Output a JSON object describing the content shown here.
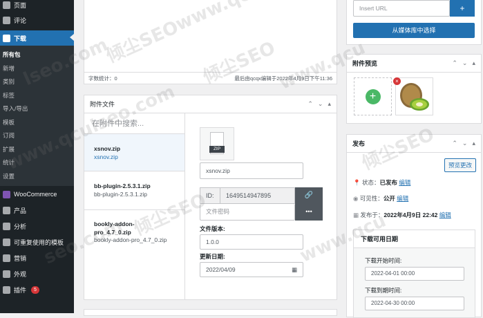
{
  "sidebar": {
    "pages_label": "页面",
    "comments_label": "评论",
    "downloads_label": "下载",
    "sub_items": [
      "所有包",
      "新增",
      "类别",
      "标签",
      "导入/导出",
      "模板",
      "订阅",
      "扩展",
      "统计",
      "设置"
    ],
    "woocommerce_label": "WooCommerce",
    "products_label": "产品",
    "analytics_label": "分析",
    "reusable_blocks_label": "可重复使用的模板",
    "marketing_label": "营销",
    "appearance_label": "外观",
    "plugins_label": "插件",
    "plugins_badge": "5"
  },
  "editor": {
    "word_count": "字数统计：0",
    "last_edited": "最后由qcqx编辑于2022年4月9日下午11:36"
  },
  "attachments": {
    "title": "附件文件",
    "search_placeholder": "在附件中搜索...",
    "files": [
      {
        "title": "xsnov.zip",
        "sub": "xsnov.zip"
      },
      {
        "title": "bb-plugin-2.5.3.1.zip",
        "sub": "bb-plugin-2.5.3.1.zip"
      },
      {
        "title": "bookly-addon-pro_4.7_0.zip",
        "sub": "bookly-addon-pro_4.7_0.zip"
      }
    ],
    "detail": {
      "file_icon_text": "ZIP",
      "filename": "xsnov.zip",
      "id_label": "ID:",
      "id_value": "1649514947895",
      "password_placeholder": "文件密码",
      "version_label": "文件版本:",
      "version_value": "1.0.0",
      "updated_label": "更新日期:",
      "updated_value": "2022/04/09"
    }
  },
  "url_box": {
    "insert_url_placeholder": "Insert URL",
    "media_button": "从媒体库中选择"
  },
  "preview": {
    "title": "附件预览"
  },
  "publish": {
    "title": "发布",
    "preview_button": "预览更改",
    "status_label": "状态：",
    "status_value": "已发布",
    "edit": "编辑",
    "visibility_label": "可见性：",
    "visibility_value": "公开",
    "published_label": "发布于：",
    "published_value": "2022年4月9日 22:42",
    "dates_title": "下载可用日期",
    "start_label": "下载开始时间:",
    "start_value": "2022-04-01 00:00",
    "end_label": "下载到期时间:",
    "end_value": "2022-04-30 00:00"
  },
  "watermarks": [
    "倾尘SEO",
    "www.qcu",
    "lseo.com",
    "倾尘SEO",
    "www.qculseo.com",
    "倾尘SEO",
    "www.qcu",
    "seo.com",
    "倾尘SEO",
    "www.qcu"
  ],
  "colors": {
    "sidebar": "#1d2327",
    "accent": "#2271b1",
    "green": "#4ab866",
    "danger": "#d63638"
  }
}
